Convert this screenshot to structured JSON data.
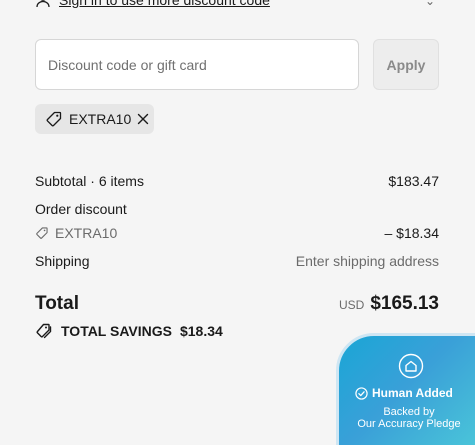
{
  "signin": {
    "link_text": "Sign in to use more discount code"
  },
  "discount": {
    "placeholder": "Discount code or gift card",
    "value": "",
    "apply_label": "Apply"
  },
  "applied_code": {
    "code": "EXTRA10"
  },
  "summary": {
    "subtotal_label": "Subtotal · 6 items",
    "subtotal_value": "$183.47",
    "order_discount_label": "Order discount",
    "discount_code": "EXTRA10",
    "discount_value": "– $18.34",
    "shipping_label": "Shipping",
    "shipping_value": "Enter shipping address",
    "total_label": "Total",
    "currency": "USD",
    "total_value": "$165.13",
    "savings_label": "TOTAL SAVINGS",
    "savings_value": "$18.34"
  },
  "badge": {
    "title": "Human Added",
    "line1": "Backed by",
    "line2": "Our Accuracy Pledge"
  }
}
